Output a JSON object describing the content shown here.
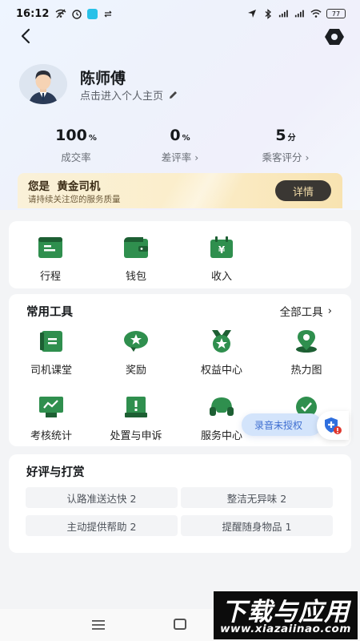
{
  "status_bar": {
    "time": "16:12",
    "battery": "77"
  },
  "profile": {
    "name": "陈师傅",
    "link_text": "点击进入个人主页"
  },
  "stats": [
    {
      "value": "100",
      "unit": "%",
      "label": "成交率",
      "has_arrow": false
    },
    {
      "value": "0",
      "unit": "%",
      "label": "差评率",
      "has_arrow": true
    },
    {
      "value": "5",
      "unit": "分",
      "label": "乘客评分",
      "has_arrow": true
    }
  ],
  "gold_banner": {
    "title": "您是  黄金司机",
    "subtitle": "请持续关注您的服务质量",
    "button": "详情"
  },
  "quick_actions": [
    {
      "label": "行程",
      "icon": "trip-icon"
    },
    {
      "label": "钱包",
      "icon": "wallet-icon"
    },
    {
      "label": "收入",
      "icon": "income-icon"
    }
  ],
  "tools": {
    "title": "常用工具",
    "all_label": "全部工具",
    "items": [
      {
        "label": "司机课堂",
        "icon": "classroom-icon"
      },
      {
        "label": "奖励",
        "icon": "reward-icon"
      },
      {
        "label": "权益中心",
        "icon": "benefits-icon"
      },
      {
        "label": "热力图",
        "icon": "heatmap-icon"
      },
      {
        "label": "考核统计",
        "icon": "assessment-icon"
      },
      {
        "label": "处置与申诉",
        "icon": "appeal-icon"
      },
      {
        "label": "服务中心",
        "icon": "service-icon"
      },
      {
        "label": "",
        "icon": "safety-icon"
      }
    ]
  },
  "reviews": {
    "title": "好评与打赏",
    "tags": [
      "认路准送达快 2",
      "整洁无异味 2",
      "主动提供帮助 2",
      "提醒随身物品 1"
    ]
  },
  "recording": {
    "label": "录音未授权"
  },
  "watermark": {
    "title": "下载与应用",
    "url": "www.xiazaiinao.com"
  },
  "colors": {
    "icon_green": "#2f8f4e",
    "icon_dark": "#1d5f33",
    "accent_blue": "#3f6fd1",
    "gold_dark": "#3a3733"
  }
}
